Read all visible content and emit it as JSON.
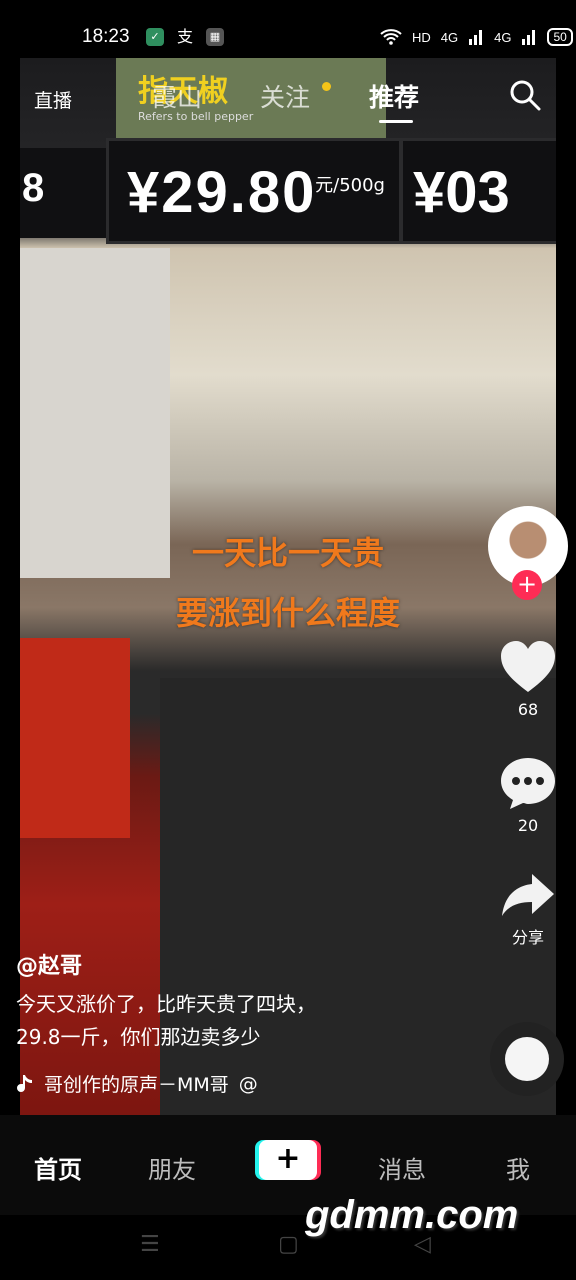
{
  "status": {
    "time": "18:23",
    "app_icons": [
      "wechat-icon",
      "alipay-icon",
      "sim-icon"
    ],
    "app_glyphs": [
      "✓",
      "支",
      "▦"
    ],
    "network": [
      "HD",
      "4G",
      "4G"
    ],
    "battery": "50"
  },
  "top_nav": {
    "live": "直播",
    "tabs": [
      "霞山",
      "关注",
      "推荐"
    ],
    "active": "推荐"
  },
  "scene": {
    "sign_title": "指天椒",
    "sign_subtitle": "Refers to bell pepper",
    "price_main": "¥29.80",
    "price_unit": "元/500g",
    "price_right": "¥03",
    "price_left": "8"
  },
  "caption": {
    "line1": "一天比一天贵",
    "line2": "要涨到什么程度"
  },
  "side_actions": {
    "like_count": "68",
    "comment_count": "20",
    "share_label": "分享",
    "follow_plus": "+"
  },
  "post": {
    "author": "@赵哥",
    "desc_line1": "今天又涨价了，比昨天贵了四块，",
    "desc_line2": "29.8一斤，你们那边卖多少",
    "music": "哥创作的原声－MM哥",
    "music_suffix": "@"
  },
  "tabbar": {
    "home": "首页",
    "friends": "朋友",
    "create": "+",
    "messages": "消息",
    "me": "我"
  },
  "watermark": "gdmm.com"
}
